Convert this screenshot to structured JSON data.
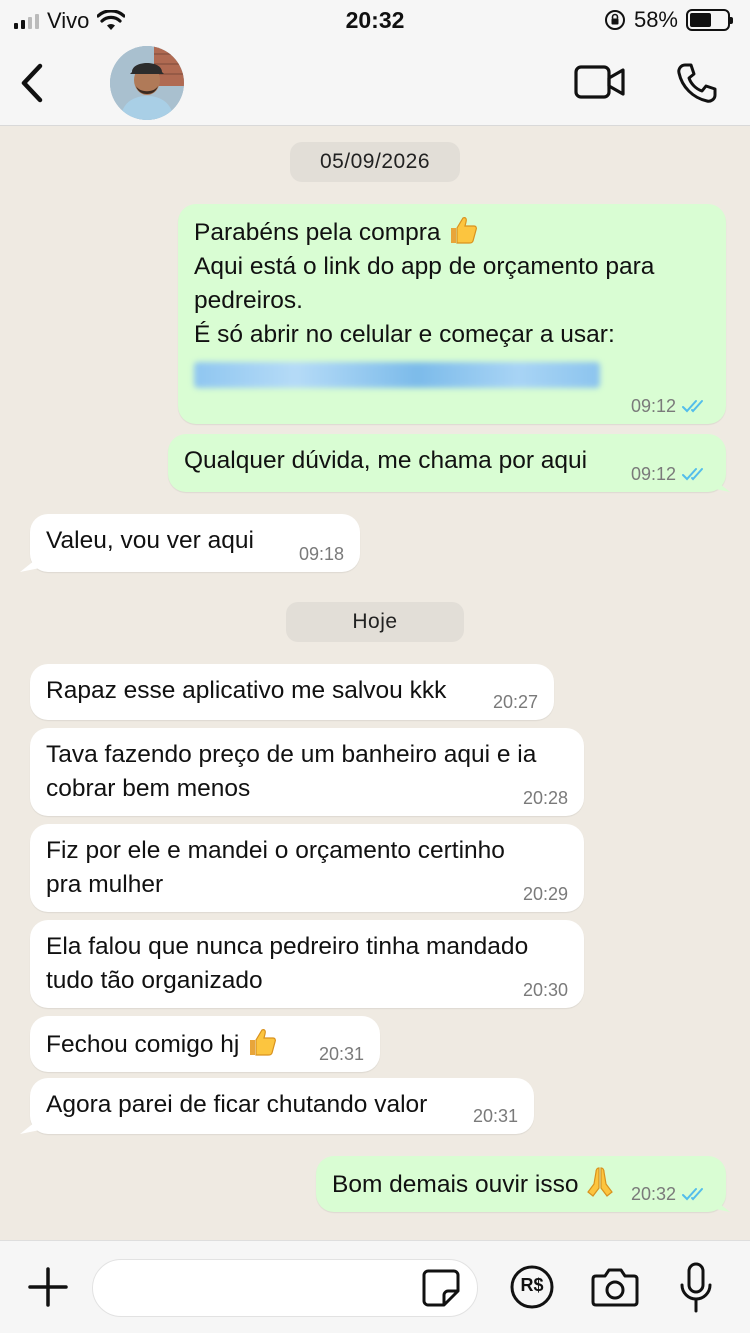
{
  "status_bar": {
    "carrier": "Vivo",
    "time": "20:32",
    "battery": "58%",
    "battery_level": 0.58
  },
  "header": {
    "back_icon": "chevron-left-icon",
    "video_icon": "video-camera-icon",
    "call_icon": "phone-icon"
  },
  "chat": {
    "date_chips": [
      "05/09/2026",
      "Hoje"
    ],
    "messages": [
      {
        "dir": "out",
        "lines": [
          "Parabéns pela compra",
          "Aqui está o link do app de orçamento para",
          "pedreiros.",
          "É só abrir no celular e começar a usar:"
        ],
        "time": "09:12",
        "read": true
      },
      {
        "dir": "out",
        "text": "Qualquer dúvida, me chama por aqui",
        "time": "09:12",
        "read": true
      },
      {
        "dir": "in",
        "text": "Valeu, vou ver aqui",
        "time": "09:18"
      },
      {
        "dir": "in",
        "text": "Rapaz esse aplicativo me salvou kkk",
        "time": "20:27"
      },
      {
        "dir": "in",
        "lines": [
          "Tava fazendo preço de um banheiro aqui e ia",
          "cobrar bem menos"
        ],
        "time": "20:28"
      },
      {
        "dir": "in",
        "lines": [
          "Fiz por ele e mandei o orçamento certinho",
          "pra mulher"
        ],
        "time": "20:29"
      },
      {
        "dir": "in",
        "lines": [
          "Ela falou que nunca pedreiro tinha mandado",
          "tudo tão organizado"
        ],
        "time": "20:30"
      },
      {
        "dir": "in",
        "text": "Fechou comigo hj",
        "time": "20:31"
      },
      {
        "dir": "in",
        "text": "Agora parei de ficar chutando valor",
        "time": "20:31"
      },
      {
        "dir": "out",
        "text": "Bom demais ouvir isso",
        "time": "20:32",
        "read": true
      }
    ]
  },
  "input_bar": {
    "message_value": "",
    "pay_label": "R$"
  },
  "colors": {
    "chat_background": "#efeae2",
    "outgoing_bubble": "#d9fdd3",
    "incoming_bubble": "#ffffff",
    "read_ticks": "#53bdeb",
    "link_blur": "#8fc6f0"
  }
}
